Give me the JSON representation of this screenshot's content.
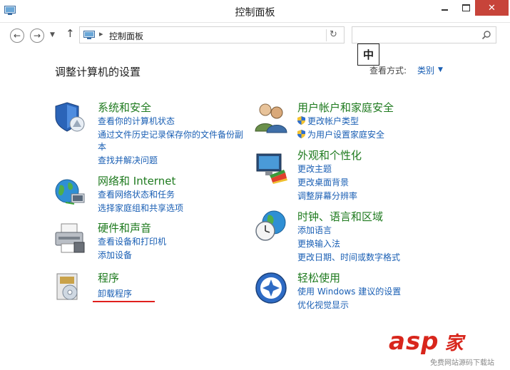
{
  "window": {
    "title": "控制面板"
  },
  "address": {
    "path": "控制面板",
    "search_placeholder": ""
  },
  "ime": {
    "indicator": "中"
  },
  "header": {
    "title": "调整计算机的设置",
    "view_by_label": "查看方式:",
    "view_by_value": "类别"
  },
  "categories": [
    {
      "title": "系统和安全",
      "icon": "shield-icon",
      "links": [
        "查看你的计算机状态",
        "通过文件历史记录保存你的文件备份副",
        "本",
        "查找并解决问题"
      ]
    },
    {
      "title": "网络和 Internet",
      "icon": "network-globe-icon",
      "links": [
        "查看网络状态和任务",
        "选择家庭组和共享选项"
      ]
    },
    {
      "title": "硬件和声音",
      "icon": "printer-icon",
      "links": [
        "查看设备和打印机",
        "添加设备"
      ]
    },
    {
      "title": "程序",
      "icon": "programs-icon",
      "links": [
        "卸载程序"
      ]
    },
    {
      "title": "用户帐户和家庭安全",
      "icon": "users-icon",
      "links": [
        "更改帐户类型",
        "为用户设置家庭安全"
      ]
    },
    {
      "title": "外观和个性化",
      "icon": "display-palette-icon",
      "links": [
        "更改主题",
        "更改桌面背景",
        "调整屏幕分辨率"
      ]
    },
    {
      "title": "时钟、语言和区域",
      "icon": "clock-globe-icon",
      "links": [
        "添加语言",
        "更换输入法",
        "更改日期、时间或数字格式"
      ]
    },
    {
      "title": "轻松使用",
      "icon": "ease-of-access-icon",
      "links": [
        "使用 Windows 建议的设置",
        "优化视觉显示"
      ]
    }
  ],
  "watermark": {
    "text": "asp",
    "text2": "家",
    "sub": "免费网站源码下载站"
  },
  "colors": {
    "link": "#1a5fb4",
    "category_title": "#1e7a1e",
    "close_button": "#c7443a",
    "underline": "#e0201d"
  }
}
